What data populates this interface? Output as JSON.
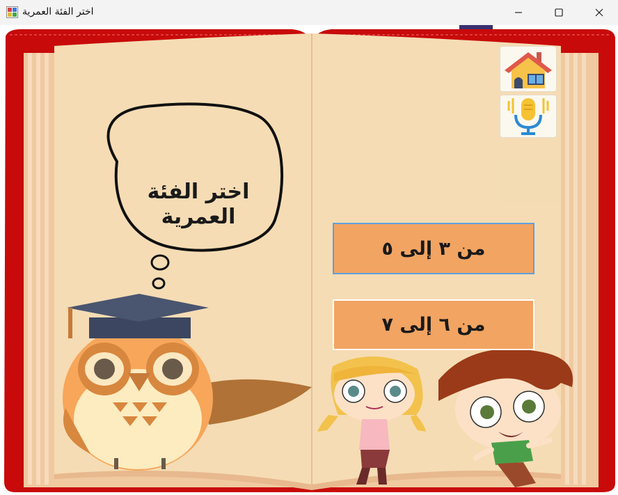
{
  "window": {
    "title": "اختر الفئة العمرية",
    "icon": "app-icon",
    "controls": {
      "minimize": "minimize-icon",
      "maximize": "maximize-icon",
      "close": "close-icon"
    }
  },
  "bubble": {
    "text_line1": "اختر الفئة",
    "text_line2": "العمرية"
  },
  "side_buttons": [
    {
      "name": "home-button",
      "icon": "house-icon"
    },
    {
      "name": "microphone-button",
      "icon": "microphone-icon"
    }
  ],
  "age_options": [
    {
      "label": "من ٣ إلى ٥"
    },
    {
      "label": "من ٦ إلى ٧"
    }
  ],
  "colors": {
    "book_cover": "#c80a0a",
    "page": "#f5dcb4",
    "button": "#f2a462",
    "button_focus_border": "#5fa0dc"
  }
}
